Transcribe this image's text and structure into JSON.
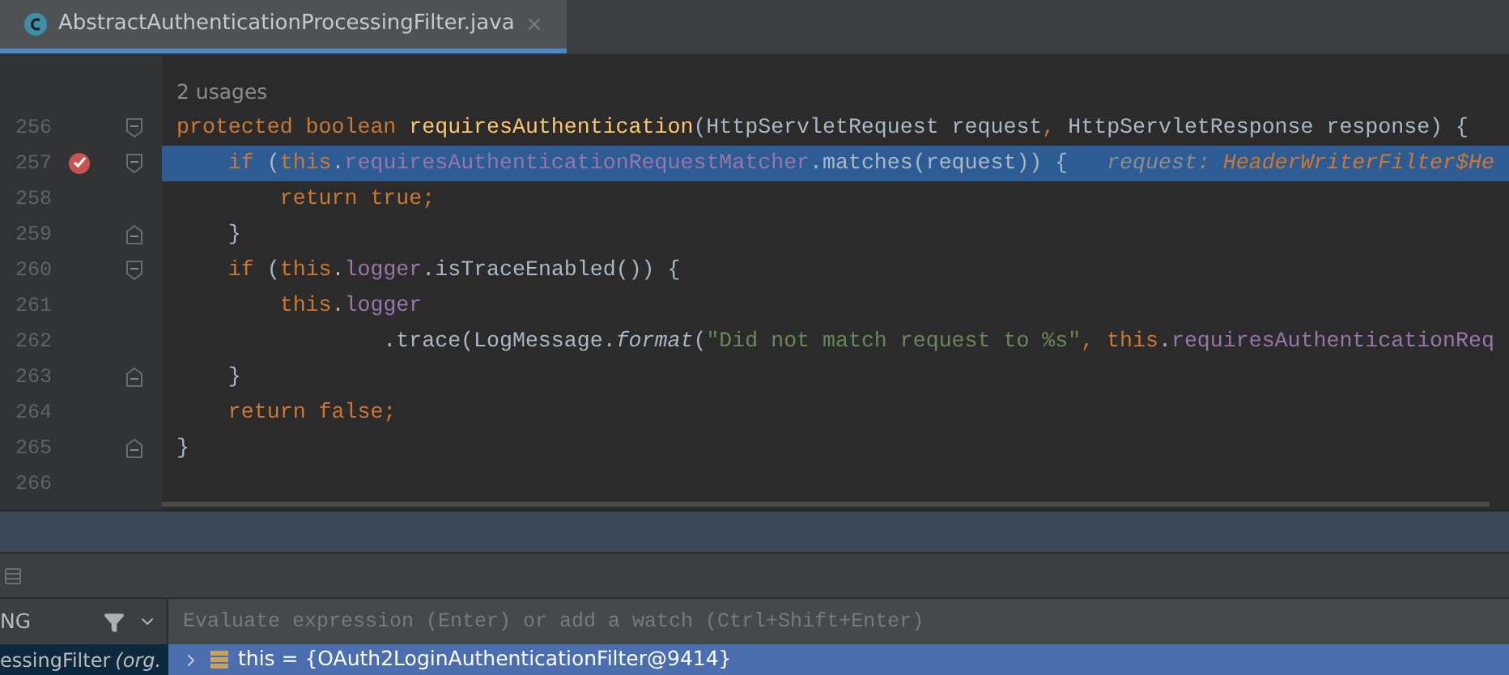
{
  "tabs": [
    {
      "title": "AbstractAuthenticationProcessingFilter.java",
      "selected": true
    }
  ],
  "editor": {
    "usages": "2 usages",
    "lines": [
      {
        "number": "256",
        "selected": false,
        "breakpoint": false,
        "fold_open": true,
        "fold_close": false,
        "tokens": [
          {
            "kind": "keyword",
            "text": "protected boolean "
          },
          {
            "kind": "method",
            "text": "requiresAuthentication"
          },
          {
            "kind": "plain",
            "text": "(HttpServletRequest request"
          },
          {
            "kind": "keyword",
            "text": ", "
          },
          {
            "kind": "plain",
            "text": "HttpServletResponse response) {"
          }
        ]
      },
      {
        "number": "257",
        "selected": true,
        "breakpoint": true,
        "fold_open": true,
        "fold_close": false,
        "tokens": [
          {
            "kind": "keyword",
            "text": "    if"
          },
          {
            "kind": "plain",
            "text": " ("
          },
          {
            "kind": "keyword",
            "text": "this"
          },
          {
            "kind": "plain",
            "text": "."
          },
          {
            "kind": "field",
            "text": "requiresAuthenticationRequestMatcher"
          },
          {
            "kind": "plain",
            "text": ".matches(request)) {   "
          },
          {
            "kind": "hint_label",
            "text": "request: "
          },
          {
            "kind": "hint_value",
            "text": "HeaderWriterFilter$He"
          }
        ]
      },
      {
        "number": "258",
        "selected": false,
        "breakpoint": false,
        "fold_open": false,
        "fold_close": false,
        "tokens": [
          {
            "kind": "keyword",
            "text": "        return true;"
          }
        ]
      },
      {
        "number": "259",
        "selected": false,
        "breakpoint": false,
        "fold_open": false,
        "fold_close": true,
        "tokens": [
          {
            "kind": "plain",
            "text": "    }"
          }
        ]
      },
      {
        "number": "260",
        "selected": false,
        "breakpoint": false,
        "fold_open": true,
        "fold_close": false,
        "tokens": [
          {
            "kind": "keyword",
            "text": "    if"
          },
          {
            "kind": "plain",
            "text": " ("
          },
          {
            "kind": "keyword",
            "text": "this"
          },
          {
            "kind": "plain",
            "text": "."
          },
          {
            "kind": "field",
            "text": "logger"
          },
          {
            "kind": "plain",
            "text": ".isTraceEnabled()) {"
          }
        ]
      },
      {
        "number": "261",
        "selected": false,
        "breakpoint": false,
        "fold_open": false,
        "fold_close": false,
        "tokens": [
          {
            "kind": "keyword",
            "text": "        this"
          },
          {
            "kind": "plain",
            "text": "."
          },
          {
            "kind": "field",
            "text": "logger"
          }
        ]
      },
      {
        "number": "262",
        "selected": false,
        "breakpoint": false,
        "fold_open": false,
        "fold_close": false,
        "tokens": [
          {
            "kind": "plain",
            "text": "                .trace(LogMessage."
          },
          {
            "kind": "italic",
            "text": "format"
          },
          {
            "kind": "plain",
            "text": "("
          },
          {
            "kind": "string",
            "text": "\"Did not match request to %s\""
          },
          {
            "kind": "keyword",
            "text": ", this"
          },
          {
            "kind": "plain",
            "text": "."
          },
          {
            "kind": "field",
            "text": "requiresAuthenticationReq"
          }
        ]
      },
      {
        "number": "263",
        "selected": false,
        "breakpoint": false,
        "fold_open": false,
        "fold_close": true,
        "tokens": [
          {
            "kind": "plain",
            "text": "    }"
          }
        ]
      },
      {
        "number": "264",
        "selected": false,
        "breakpoint": false,
        "fold_open": false,
        "fold_close": false,
        "tokens": [
          {
            "kind": "keyword",
            "text": "    return false;"
          }
        ]
      },
      {
        "number": "265",
        "selected": false,
        "breakpoint": false,
        "fold_open": false,
        "fold_close": true,
        "tokens": [
          {
            "kind": "plain",
            "text": "}"
          }
        ]
      },
      {
        "number": "266",
        "selected": false,
        "breakpoint": false,
        "fold_open": false,
        "fold_close": false
      }
    ]
  },
  "debug": {
    "frames_header": "NG",
    "evaluate": {
      "placeholder": "Evaluate expression (Enter) or add a watch (Ctrl+Shift+Enter)"
    },
    "frames": [
      {
        "name": "essingFilter",
        "package": "(org.",
        "selected": true
      }
    ],
    "variables": [
      {
        "text": "this = {OAuth2LoginAuthenticationFilter@9414}",
        "selected": true
      }
    ]
  }
}
